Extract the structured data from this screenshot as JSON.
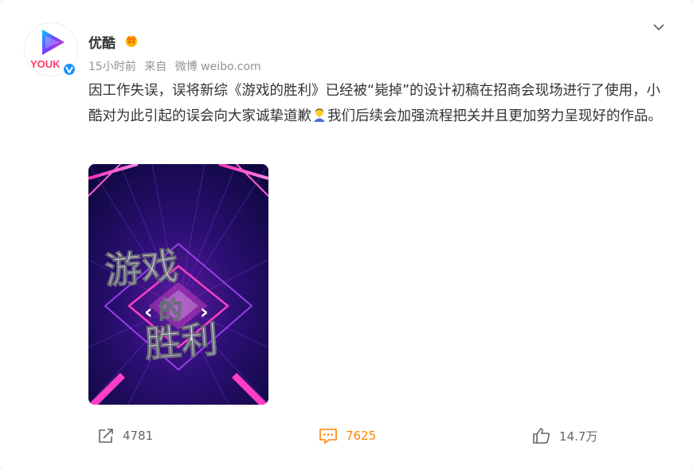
{
  "post": {
    "author": "优酷",
    "avatar_logo_text": "YOUK",
    "time": "15小时前",
    "source_prefix": "来自",
    "source": "微博 weibo.com",
    "content_part1": "因工作失误，误将新综《游戏的胜利》已经被“毙掉”的设计初稿在招商会现场进行了使用，小酷对为此引起的误会向大家诚挚道歉",
    "content_part2": "我们后续会加强流程把关并且更加努力呈现好的作品。",
    "poster_title": [
      "游戏",
      "的",
      "胜利"
    ]
  },
  "actions": {
    "repost_count": "4781",
    "comment_count": "7625",
    "like_count": "14.7万"
  },
  "colors": {
    "accent_orange": "#ff8200",
    "meta_gray": "#939393",
    "verify_blue": "#1e90ff"
  },
  "icons": [
    "youku-logo-icon",
    "vip-crown-icon",
    "chevron-down-icon",
    "bowing-emoji-icon",
    "repost-icon",
    "comment-icon",
    "like-icon"
  ]
}
